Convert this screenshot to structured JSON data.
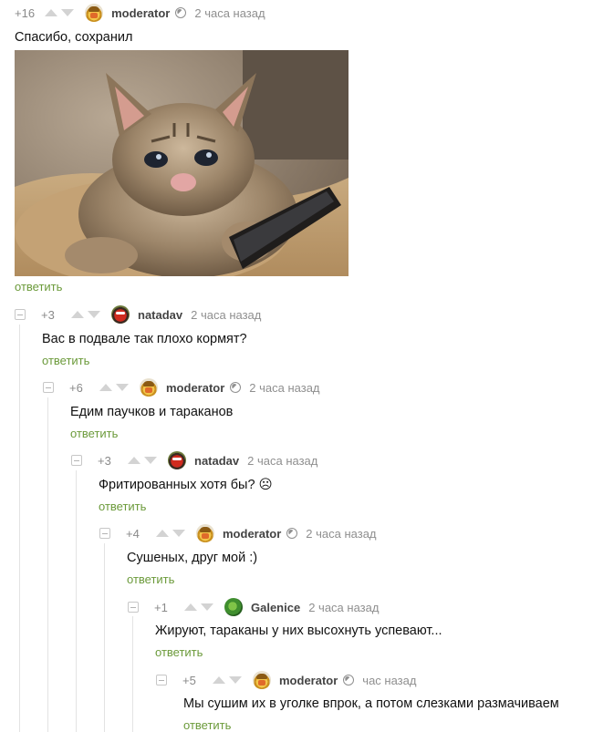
{
  "comments": [
    {
      "rating": "+16",
      "author": "moderator",
      "time": "2 часа назад",
      "text": "Спасибо, сохранил",
      "reply": "ответить",
      "avatar": "moderator-avatar",
      "is_moderator": true,
      "has_image": true
    },
    {
      "rating": "+3",
      "author": "natadav",
      "time": "2 часа назад",
      "text": "Вас в подвале так плохо кормят?",
      "reply": "ответить",
      "avatar": "natadav-avatar",
      "is_moderator": false
    },
    {
      "rating": "+6",
      "author": "moderator",
      "time": "2 часа назад",
      "text": "Едим паучков и тараканов",
      "reply": "ответить",
      "avatar": "moderator-avatar",
      "is_moderator": true
    },
    {
      "rating": "+3",
      "author": "natadav",
      "time": "2 часа назад",
      "text": "Фритированных хотя бы? ☹",
      "reply": "ответить",
      "avatar": "natadav-avatar",
      "is_moderator": false
    },
    {
      "rating": "+4",
      "author": "moderator",
      "time": "2 часа назад",
      "text": "Сушеных, друг мой :)",
      "reply": "ответить",
      "avatar": "moderator-avatar",
      "is_moderator": true
    },
    {
      "rating": "+1",
      "author": "Galenice",
      "time": "2 часа назад",
      "text": "Жируют, тараканы у них высохнуть успевают...",
      "reply": "ответить",
      "avatar": "galenice-avatar",
      "is_moderator": false
    },
    {
      "rating": "+5",
      "author": "moderator",
      "time": "час назад",
      "text": "Мы сушим их в уголке впрок, а потом слезками размачиваем",
      "reply": "ответить",
      "avatar": "moderator-avatar",
      "is_moderator": true
    }
  ],
  "image": {
    "subject": "sad-crying-kitten-holding-phone-image"
  },
  "colors": {
    "reply_link": "#6b9a3a",
    "meta_gray": "#8f8f8f",
    "vote_arrow": "#d3d3d3",
    "thread_line": "#e3e3e3"
  }
}
